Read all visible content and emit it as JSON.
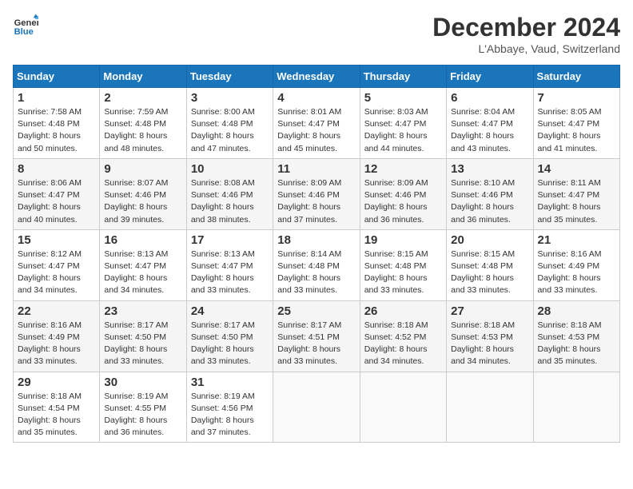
{
  "logo": {
    "line1": "General",
    "line2": "Blue"
  },
  "title": "December 2024",
  "location": "L'Abbaye, Vaud, Switzerland",
  "days_of_week": [
    "Sunday",
    "Monday",
    "Tuesday",
    "Wednesday",
    "Thursday",
    "Friday",
    "Saturday"
  ],
  "weeks": [
    [
      {
        "day": "1",
        "sunrise": "7:58 AM",
        "sunset": "4:48 PM",
        "daylight": "8 hours and 50 minutes."
      },
      {
        "day": "2",
        "sunrise": "7:59 AM",
        "sunset": "4:48 PM",
        "daylight": "8 hours and 48 minutes."
      },
      {
        "day": "3",
        "sunrise": "8:00 AM",
        "sunset": "4:48 PM",
        "daylight": "8 hours and 47 minutes."
      },
      {
        "day": "4",
        "sunrise": "8:01 AM",
        "sunset": "4:47 PM",
        "daylight": "8 hours and 45 minutes."
      },
      {
        "day": "5",
        "sunrise": "8:03 AM",
        "sunset": "4:47 PM",
        "daylight": "8 hours and 44 minutes."
      },
      {
        "day": "6",
        "sunrise": "8:04 AM",
        "sunset": "4:47 PM",
        "daylight": "8 hours and 43 minutes."
      },
      {
        "day": "7",
        "sunrise": "8:05 AM",
        "sunset": "4:47 PM",
        "daylight": "8 hours and 41 minutes."
      }
    ],
    [
      {
        "day": "8",
        "sunrise": "8:06 AM",
        "sunset": "4:47 PM",
        "daylight": "8 hours and 40 minutes."
      },
      {
        "day": "9",
        "sunrise": "8:07 AM",
        "sunset": "4:46 PM",
        "daylight": "8 hours and 39 minutes."
      },
      {
        "day": "10",
        "sunrise": "8:08 AM",
        "sunset": "4:46 PM",
        "daylight": "8 hours and 38 minutes."
      },
      {
        "day": "11",
        "sunrise": "8:09 AM",
        "sunset": "4:46 PM",
        "daylight": "8 hours and 37 minutes."
      },
      {
        "day": "12",
        "sunrise": "8:09 AM",
        "sunset": "4:46 PM",
        "daylight": "8 hours and 36 minutes."
      },
      {
        "day": "13",
        "sunrise": "8:10 AM",
        "sunset": "4:46 PM",
        "daylight": "8 hours and 36 minutes."
      },
      {
        "day": "14",
        "sunrise": "8:11 AM",
        "sunset": "4:47 PM",
        "daylight": "8 hours and 35 minutes."
      }
    ],
    [
      {
        "day": "15",
        "sunrise": "8:12 AM",
        "sunset": "4:47 PM",
        "daylight": "8 hours and 34 minutes."
      },
      {
        "day": "16",
        "sunrise": "8:13 AM",
        "sunset": "4:47 PM",
        "daylight": "8 hours and 34 minutes."
      },
      {
        "day": "17",
        "sunrise": "8:13 AM",
        "sunset": "4:47 PM",
        "daylight": "8 hours and 33 minutes."
      },
      {
        "day": "18",
        "sunrise": "8:14 AM",
        "sunset": "4:48 PM",
        "daylight": "8 hours and 33 minutes."
      },
      {
        "day": "19",
        "sunrise": "8:15 AM",
        "sunset": "4:48 PM",
        "daylight": "8 hours and 33 minutes."
      },
      {
        "day": "20",
        "sunrise": "8:15 AM",
        "sunset": "4:48 PM",
        "daylight": "8 hours and 33 minutes."
      },
      {
        "day": "21",
        "sunrise": "8:16 AM",
        "sunset": "4:49 PM",
        "daylight": "8 hours and 33 minutes."
      }
    ],
    [
      {
        "day": "22",
        "sunrise": "8:16 AM",
        "sunset": "4:49 PM",
        "daylight": "8 hours and 33 minutes."
      },
      {
        "day": "23",
        "sunrise": "8:17 AM",
        "sunset": "4:50 PM",
        "daylight": "8 hours and 33 minutes."
      },
      {
        "day": "24",
        "sunrise": "8:17 AM",
        "sunset": "4:50 PM",
        "daylight": "8 hours and 33 minutes."
      },
      {
        "day": "25",
        "sunrise": "8:17 AM",
        "sunset": "4:51 PM",
        "daylight": "8 hours and 33 minutes."
      },
      {
        "day": "26",
        "sunrise": "8:18 AM",
        "sunset": "4:52 PM",
        "daylight": "8 hours and 34 minutes."
      },
      {
        "day": "27",
        "sunrise": "8:18 AM",
        "sunset": "4:53 PM",
        "daylight": "8 hours and 34 minutes."
      },
      {
        "day": "28",
        "sunrise": "8:18 AM",
        "sunset": "4:53 PM",
        "daylight": "8 hours and 35 minutes."
      }
    ],
    [
      {
        "day": "29",
        "sunrise": "8:18 AM",
        "sunset": "4:54 PM",
        "daylight": "8 hours and 35 minutes."
      },
      {
        "day": "30",
        "sunrise": "8:19 AM",
        "sunset": "4:55 PM",
        "daylight": "8 hours and 36 minutes."
      },
      {
        "day": "31",
        "sunrise": "8:19 AM",
        "sunset": "4:56 PM",
        "daylight": "8 hours and 37 minutes."
      },
      null,
      null,
      null,
      null
    ]
  ]
}
